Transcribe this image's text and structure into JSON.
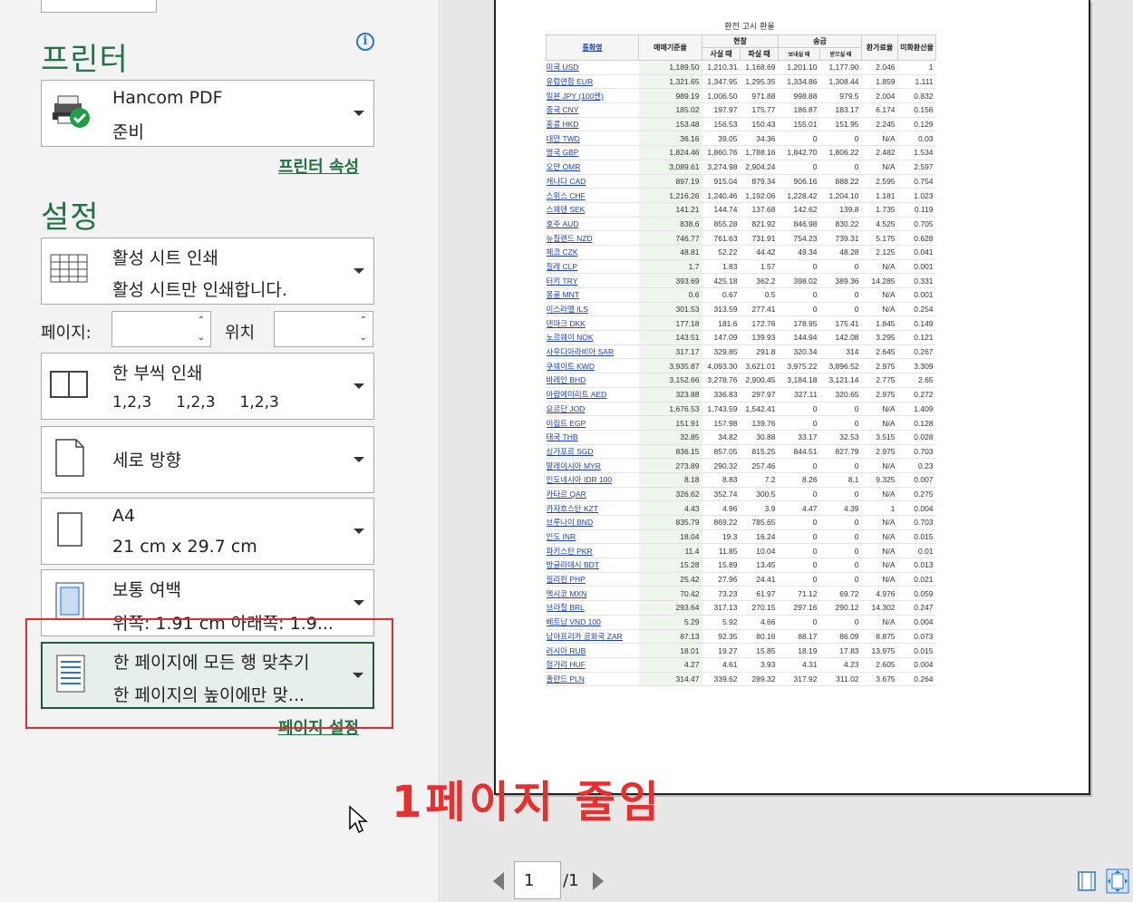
{
  "printer": {
    "title": "프린터",
    "device_name": "Hancom PDF",
    "device_status": "준비",
    "properties_link": "프린터 속성"
  },
  "settings": {
    "title": "설정",
    "scope": {
      "line1": "활성 시트 인쇄",
      "line2": "활성 시트만 인쇄합니다."
    },
    "pages_label": "페이지:",
    "to_label": "위치",
    "pages_from": "",
    "pages_to": "",
    "collate": {
      "line1": "한 부씩 인쇄",
      "line2": "1,2,3     1,2,3     1,2,3"
    },
    "orientation": {
      "line1": "세로 방향"
    },
    "paper": {
      "line1": "A4",
      "line2": "21 cm x 29.7 cm"
    },
    "margins": {
      "line1": "보통 여백",
      "line2": "위쪽: 1.91 cm 아래쪽: 1.9..."
    },
    "scaling": {
      "line1": "한 페이지에 모든 행 맞추기",
      "line2": "한 페이지의 높이에만 맞..."
    },
    "page_setup_link": "페이지 설정"
  },
  "annotation": {
    "text": "1페이지 줄임",
    "color": "#e53030"
  },
  "preview": {
    "sheet_title": "환전 고시 환율",
    "header": {
      "currency": "통화명",
      "base_rate": "매매기준율",
      "cash": "현찰",
      "cash_buy": "사실 때",
      "cash_sell": "파실 때",
      "transfer": "송금",
      "transfer_send": "보내실 때",
      "transfer_recv": "받으실 때",
      "commission": "환가료율",
      "usd_rate": "미화환산율"
    },
    "rows": [
      [
        "미국 USD",
        "1,189.50",
        "1,210.31",
        "1,168.69",
        "1,201.10",
        "1,177.90",
        "2.046",
        "1"
      ],
      [
        "유럽연합 EUR",
        "1,321.65",
        "1,347.95",
        "1,295.35",
        "1,334.86",
        "1,308.44",
        "1.859",
        "1.111"
      ],
      [
        "일본 JPY (100엔)",
        "989.19",
        "1,006.50",
        "971.88",
        "998.88",
        "979.5",
        "2.004",
        "0.832"
      ],
      [
        "중국 CNY",
        "185.02",
        "197.97",
        "175.77",
        "186.87",
        "183.17",
        "6.174",
        "0.156"
      ],
      [
        "홍콩 HKD",
        "153.48",
        "156.53",
        "150.43",
        "155.01",
        "151.95",
        "2.245",
        "0.129"
      ],
      [
        "대만 TWD",
        "36.16",
        "39.05",
        "34.36",
        "0",
        "0",
        "N/A",
        "0.03"
      ],
      [
        "영국 GBP",
        "1,824.46",
        "1,860.76",
        "1,788.16",
        "1,842.70",
        "1,806.22",
        "2.482",
        "1.534"
      ],
      [
        "오만 OMR",
        "3,089.61",
        "3,274.98",
        "2,904.24",
        "0",
        "0",
        "N/A",
        "2.597"
      ],
      [
        "캐나다 CAD",
        "897.19",
        "915.04",
        "879.34",
        "906.16",
        "888.22",
        "2.595",
        "0.754"
      ],
      [
        "스위스 CHF",
        "1,216.26",
        "1,240.46",
        "1,192.06",
        "1,228.42",
        "1,204.10",
        "1.181",
        "1.023"
      ],
      [
        "스웨덴 SEK",
        "141.21",
        "144.74",
        "137.68",
        "142.62",
        "139.8",
        "1.735",
        "0.119"
      ],
      [
        "호주 AUD",
        "838.6",
        "855.28",
        "821.92",
        "846.98",
        "830.22",
        "4.525",
        "0.705"
      ],
      [
        "뉴질랜드 NZD",
        "746.77",
        "761.63",
        "731.91",
        "754.23",
        "739.31",
        "5.175",
        "0.628"
      ],
      [
        "체코 CZK",
        "48.81",
        "52.22",
        "44.42",
        "49.34",
        "48.28",
        "2.125",
        "0.041"
      ],
      [
        "칠레 CLP",
        "1.7",
        "1.83",
        "1.57",
        "0",
        "0",
        "N/A",
        "0.001"
      ],
      [
        "터키 TRY",
        "393.69",
        "425.18",
        "362.2",
        "398.02",
        "389.36",
        "14.285",
        "0.331"
      ],
      [
        "몽골 MNT",
        "0.6",
        "0.67",
        "0.5",
        "0",
        "0",
        "N/A",
        "0.001"
      ],
      [
        "이스라엘 ILS",
        "301.53",
        "313.59",
        "277.41",
        "0",
        "0",
        "N/A",
        "0.254"
      ],
      [
        "덴마크 DKK",
        "177.18",
        "181.6",
        "172.76",
        "178.95",
        "175.41",
        "1.845",
        "0.149"
      ],
      [
        "노르웨이 NOK",
        "143.51",
        "147.09",
        "139.93",
        "144.94",
        "142.08",
        "3.295",
        "0.121"
      ],
      [
        "사우디아라비아 SAR",
        "317.17",
        "329.85",
        "291.8",
        "320.34",
        "314",
        "2.645",
        "0.267"
      ],
      [
        "쿠웨이트 KWD",
        "3,935.87",
        "4,093.30",
        "3,621.01",
        "3,975.22",
        "3,896.52",
        "2.975",
        "3.309"
      ],
      [
        "바레인 BHD",
        "3,152.66",
        "3,278.76",
        "2,900.45",
        "3,184.18",
        "3,121.14",
        "2.775",
        "2.65"
      ],
      [
        "아랍에미리트 AED",
        "323.88",
        "336.83",
        "297.97",
        "327.11",
        "320.65",
        "2.975",
        "0.272"
      ],
      [
        "요르단 JOD",
        "1,676.53",
        "1,743.59",
        "1,542.41",
        "0",
        "0",
        "N/A",
        "1.409"
      ],
      [
        "이집트 EGP",
        "151.91",
        "157.98",
        "139.76",
        "0",
        "0",
        "N/A",
        "0.128"
      ],
      [
        "태국 THB",
        "32.85",
        "34.82",
        "30.88",
        "33.17",
        "32.53",
        "3.515",
        "0.028"
      ],
      [
        "싱가포르 SGD",
        "836.15",
        "857.05",
        "815.25",
        "844.51",
        "827.79",
        "2.975",
        "0.703"
      ],
      [
        "말레이시아 MYR",
        "273.89",
        "290.32",
        "257.46",
        "0",
        "0",
        "N/A",
        "0.23"
      ],
      [
        "인도네시아 IDR 100",
        "8.18",
        "8.83",
        "7.2",
        "8.26",
        "8.1",
        "9.325",
        "0.007"
      ],
      [
        "카타르 QAR",
        "326.62",
        "352.74",
        "300.5",
        "0",
        "0",
        "N/A",
        "0.275"
      ],
      [
        "카자흐스탄 KZT",
        "4.43",
        "4.96",
        "3.9",
        "4.47",
        "4.39",
        "1",
        "0.004"
      ],
      [
        "브루나이 BND",
        "835.79",
        "869.22",
        "785.65",
        "0",
        "0",
        "N/A",
        "0.703"
      ],
      [
        "인도 INR",
        "18.04",
        "19.3",
        "16.24",
        "0",
        "0",
        "N/A",
        "0.015"
      ],
      [
        "파키스탄 PKR",
        "11.4",
        "11.85",
        "10.04",
        "0",
        "0",
        "N/A",
        "0.01"
      ],
      [
        "방글라데시 BDT",
        "15.28",
        "15.89",
        "13.45",
        "0",
        "0",
        "N/A",
        "0.013"
      ],
      [
        "필리핀 PHP",
        "25.42",
        "27.96",
        "24.41",
        "0",
        "0",
        "N/A",
        "0.021"
      ],
      [
        "멕시코 MXN",
        "70.42",
        "73.23",
        "61.97",
        "71.12",
        "69.72",
        "4.976",
        "0.059"
      ],
      [
        "브라질 BRL",
        "293.64",
        "317.13",
        "270.15",
        "297.16",
        "290.12",
        "14.302",
        "0.247"
      ],
      [
        "베트남 VND 100",
        "5.29",
        "5.92",
        "4.66",
        "0",
        "0",
        "N/A",
        "0.004"
      ],
      [
        "남아프리카 공화국 ZAR",
        "87.13",
        "92.35",
        "80.16",
        "88.17",
        "86.09",
        "8.875",
        "0.073"
      ],
      [
        "러시아 RUB",
        "18.01",
        "19.27",
        "15.85",
        "18.19",
        "17.83",
        "13.975",
        "0.015"
      ],
      [
        "헝가리 HUF",
        "4.27",
        "4.61",
        "3.93",
        "4.31",
        "4.23",
        "2.605",
        "0.004"
      ],
      [
        "폴란드 PLN",
        "314.47",
        "339.62",
        "289.32",
        "317.92",
        "311.02",
        "3.675",
        "0.264"
      ]
    ]
  },
  "pager": {
    "current": "1",
    "total": "/1"
  }
}
